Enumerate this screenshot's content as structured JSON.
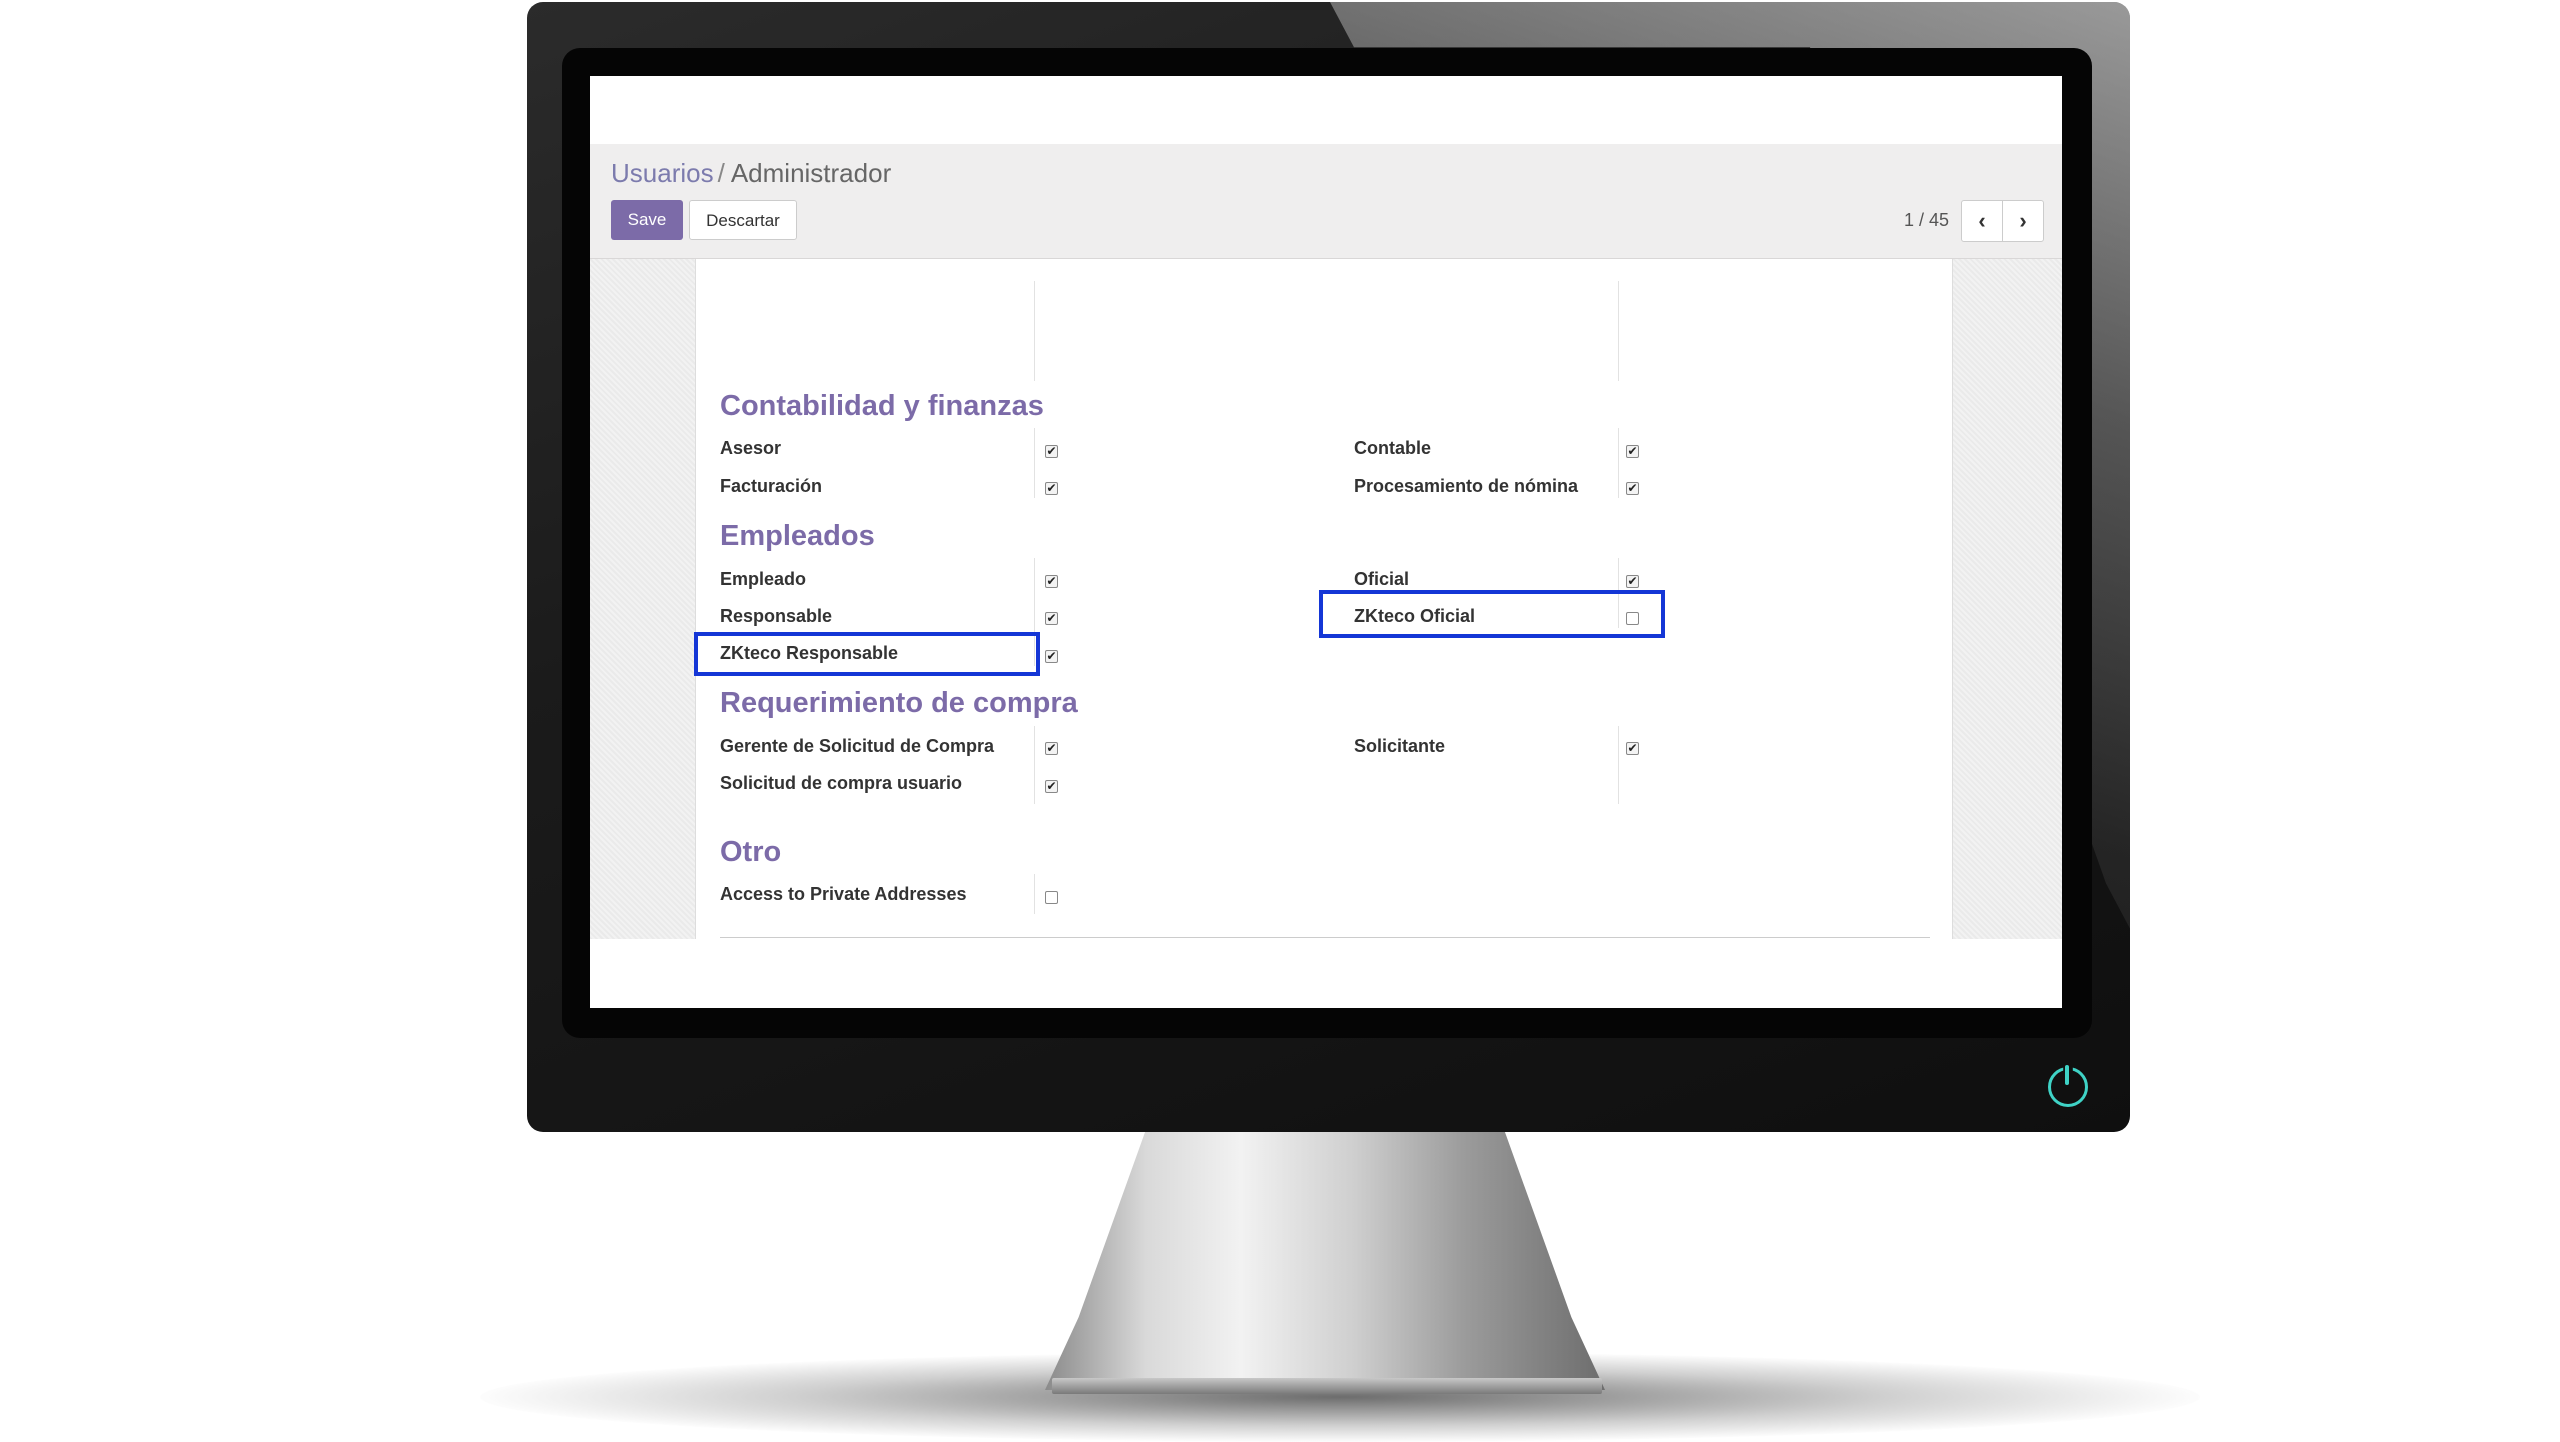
{
  "breadcrumb": {
    "parent": "Usuarios",
    "separator": "/",
    "current": "Administrador"
  },
  "buttons": {
    "save": "Save",
    "discard": "Descartar"
  },
  "pager": {
    "value": "1 / 45",
    "prev_icon": "chevron-left-icon",
    "next_icon": "chevron-right-icon"
  },
  "sections": {
    "contabilidad": {
      "title": "Contabilidad y finanzas",
      "left": [
        {
          "label": "Asesor",
          "checked": true
        },
        {
          "label": "Facturación",
          "checked": true
        }
      ],
      "right": [
        {
          "label": "Contable",
          "checked": true
        },
        {
          "label": "Procesamiento de nómina",
          "checked": true
        }
      ]
    },
    "empleados": {
      "title": "Empleados",
      "left": [
        {
          "label": "Empleado",
          "checked": true
        },
        {
          "label": "Responsable",
          "checked": true
        },
        {
          "label": "ZKteco Responsable",
          "checked": true
        }
      ],
      "right": [
        {
          "label": "Oficial",
          "checked": true
        },
        {
          "label": "ZKteco Oficial",
          "checked": false
        }
      ]
    },
    "requerimiento": {
      "title": "Requerimiento de compra",
      "left": [
        {
          "label": "Gerente de Solicitud de Compra",
          "checked": true
        },
        {
          "label": "Solicitud de compra usuario",
          "checked": true
        }
      ],
      "right": [
        {
          "label": "Solicitante",
          "checked": true
        }
      ]
    },
    "otro": {
      "title": "Otro",
      "left": [
        {
          "label": "Access to Private Addresses",
          "checked": false
        }
      ]
    }
  },
  "colors": {
    "accent": "#7c6ba8",
    "link": "#7c7bad",
    "highlight": "#1436d6",
    "power": "#3fd3c6"
  },
  "icons": {
    "power": "power-icon",
    "check": "checkmark-icon"
  }
}
